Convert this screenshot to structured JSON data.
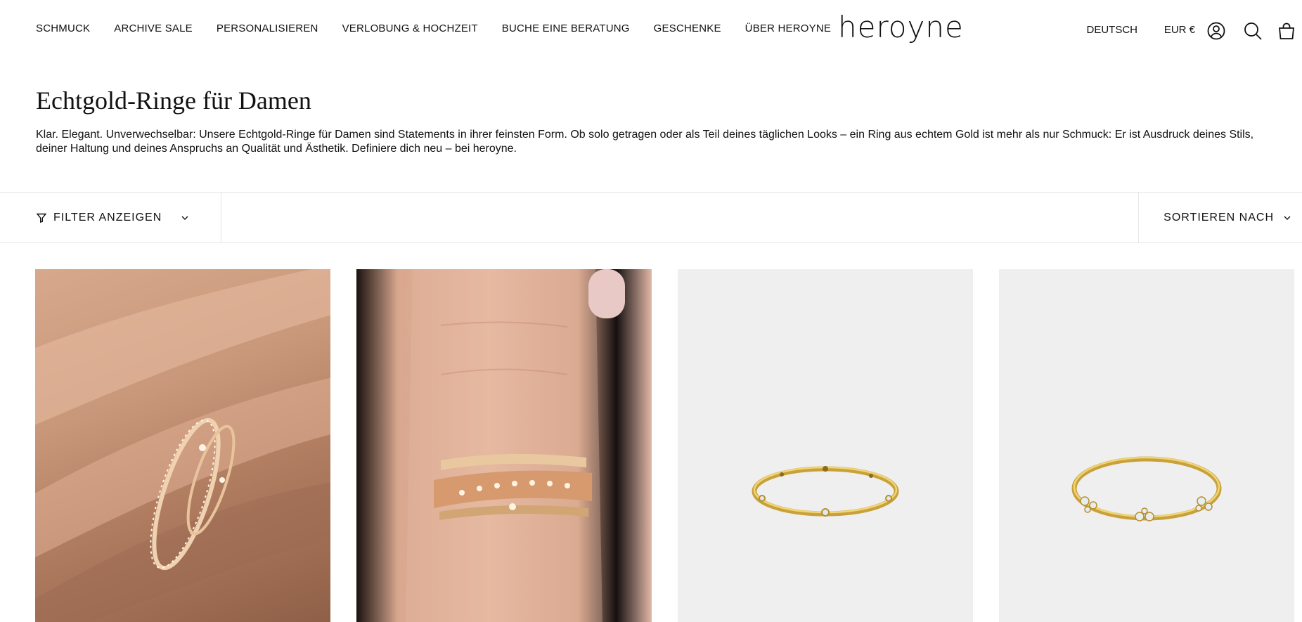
{
  "header": {
    "nav": [
      "SCHMUCK",
      "ARCHIVE SALE",
      "PERSONALISIEREN",
      "VERLOBUNG & HOCHZEIT",
      "BUCHE EINE BERATUNG",
      "GESCHENKE",
      "ÜBER HEROYNE"
    ],
    "logo": "heroyne",
    "language": "DEUTSCH",
    "currency": "EUR €",
    "icons": [
      "account-icon",
      "search-icon",
      "cart-icon"
    ]
  },
  "collection": {
    "title": "Echtgold-Ringe für Damen",
    "description": "Klar. Elegant. Unverwechselbar: Unsere Echtgold-Ringe für Damen sind Statements in ihrer feinsten Form. Ob solo getragen oder als Teil deines täglichen Looks – ein Ring aus echtem Gold ist mehr als nur Schmuck: Er ist Ausdruck deines Stils, deiner Haltung und deines Anspruchs an Qualität und Ästhetik. Definiere dich neu – bei heroyne."
  },
  "toolbar": {
    "filter_label": "FILTER ANZEIGEN",
    "sort_label": "SORTIEREN NACH"
  },
  "products": [
    {
      "image": "ring-on-hand-photo"
    },
    {
      "image": "stacked-rings-on-finger-photo"
    },
    {
      "image": "gold-ring-product-photo"
    },
    {
      "image": "gold-ring-with-stones-product-photo"
    }
  ],
  "colors": {
    "text": "#111111",
    "border": "#e6e6e6",
    "product_bg": "#efefef",
    "gold": "#d8b24a"
  }
}
